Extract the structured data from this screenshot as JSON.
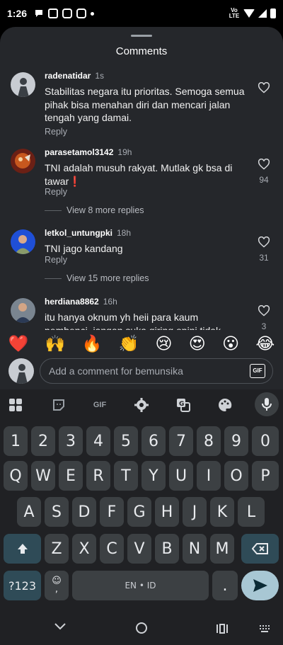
{
  "status": {
    "time": "1:26",
    "net": "Vo LTE"
  },
  "sheet": {
    "title": "Comments"
  },
  "comments": [
    {
      "user": "radenatidar",
      "time": "1s",
      "text": "Stabilitas negara itu prioritas. Semoga semua pihak bisa menahan diri dan mencari jalan tengah yang damai.",
      "reply": "Reply",
      "likes": ""
    },
    {
      "user": "parasetamol3142",
      "time": "19h",
      "text": "TNI adalah musuh rakyat. Mutlak gk bsa di tawar❗",
      "reply": "Reply",
      "likes": "94",
      "more": "View 8 more replies"
    },
    {
      "user": "letkol_untungpki",
      "time": "18h",
      "text": "TNI jago kandang",
      "reply": "Reply",
      "likes": "31",
      "more": "View 15 more replies"
    },
    {
      "user": "herdiana8862",
      "time": "16h",
      "text": "itu hanya oknum yh heii para kaum pembenci, jangan suka giring opini tidak",
      "likes": "3"
    }
  ],
  "emojis": [
    "❤️",
    "🙌",
    "🔥",
    "👏",
    "😢",
    "😍",
    "😮",
    "😂"
  ],
  "composer": {
    "placeholder": "Add a comment for bemunsika",
    "gif": "GIF"
  },
  "keyboard": {
    "toolbar_gif": "GIF",
    "row_numbers": [
      "1",
      "2",
      "3",
      "4",
      "5",
      "6",
      "7",
      "8",
      "9",
      "0"
    ],
    "row1": [
      "Q",
      "W",
      "E",
      "R",
      "T",
      "Y",
      "U",
      "I",
      "O",
      "P"
    ],
    "row2": [
      "A",
      "S",
      "D",
      "F",
      "G",
      "H",
      "J",
      "K",
      "L"
    ],
    "row3": [
      "Z",
      "X",
      "C",
      "V",
      "B",
      "N",
      "M"
    ],
    "symbols": "?123",
    "emoji_comma": ",",
    "space": "EN • ID",
    "period": "."
  }
}
